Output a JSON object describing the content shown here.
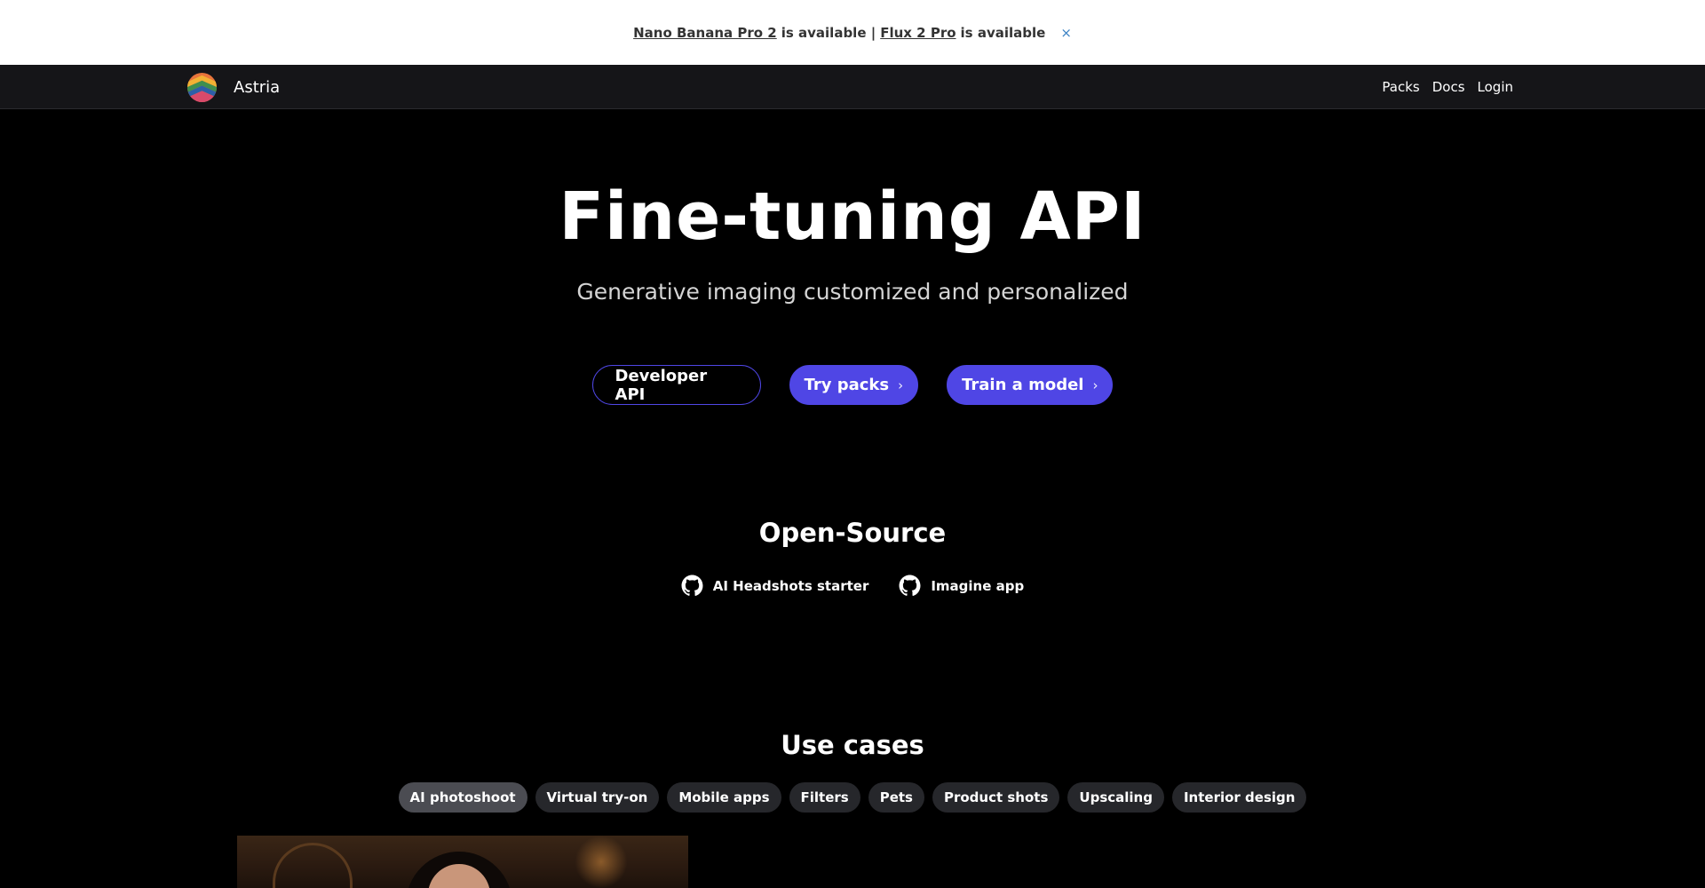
{
  "banner": {
    "link1": "Nano Banana Pro 2",
    "text1": "is available |",
    "link2": "Flux 2 Pro",
    "text2": "is available",
    "close": "×"
  },
  "nav": {
    "brand": "Astria",
    "links": [
      "Packs",
      "Docs",
      "Login"
    ]
  },
  "hero": {
    "title": "Fine-tuning API",
    "subtitle": "Generative imaging customized and personalized",
    "buttons": {
      "developer": "Developer API",
      "packs": "Try packs",
      "train": "Train a model"
    },
    "chevron": "›"
  },
  "open_source": {
    "title": "Open-Source",
    "links": [
      "AI Headshots starter",
      "Imagine app"
    ]
  },
  "use_cases": {
    "title": "Use cases",
    "tabs": [
      "AI photoshoot",
      "Virtual try-on",
      "Mobile apps",
      "Filters",
      "Pets",
      "Product shots",
      "Upscaling",
      "Interior design"
    ],
    "active_tab": "AI photoshoot"
  },
  "colors": {
    "accent": "#4f46e5",
    "background": "#000000",
    "navbar": "#151518",
    "banner": "#ffffff",
    "tab": "#26272b",
    "tab_active": "#4b4c52"
  },
  "icons": {
    "logo": "astria-logo",
    "repo": "github-icon",
    "close": "close-icon",
    "chevron": "chevron-right-icon"
  }
}
